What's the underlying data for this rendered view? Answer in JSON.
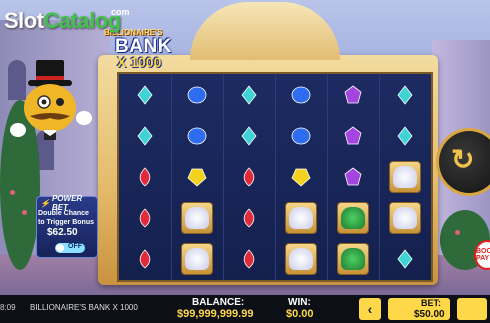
{
  "watermark": {
    "slot": "Slot",
    "catalog": "Catalog",
    "com": "com"
  },
  "logo": {
    "top": "RICHES SURGE",
    "name": "BILLIONAIRE'S",
    "bank": "BANK",
    "multiplier": "X 1000"
  },
  "power_bet": {
    "title": "POWER BET",
    "description": "Double Chance to Trigger Bonus",
    "amount": "$62.50",
    "toggle": "OFF"
  },
  "boom_badge": "BOOM PAY",
  "status_bar": {
    "time": "8:09",
    "game_name": "BILLIONAIRE'S BANK X 1000",
    "balance_label": "BALANCE:",
    "balance_value": "$99,999,999.99",
    "win_label": "WIN:",
    "win_value": "$0.00",
    "bet_label": "BET:",
    "bet_value": "$50.00",
    "prev_label": "‹"
  },
  "symbol_colors": {
    "cyan": "#3fd3d6",
    "blue": "#2f6df0",
    "purple": "#a445e0",
    "red": "#e02b3c",
    "yellow": "#f2d21e"
  },
  "reels": [
    [
      "cyan-gem",
      "cyan-gem",
      "red-gem",
      "red-gem",
      "red-gem"
    ],
    [
      "blue-gem",
      "blue-gem",
      "yellow-gem",
      "diamond-bag",
      "diamond-bag"
    ],
    [
      "cyan-gem",
      "cyan-gem",
      "red-gem",
      "red-gem",
      "red-gem"
    ],
    [
      "blue-gem",
      "blue-gem",
      "yellow-gem",
      "diamond-bag",
      "diamond-bag"
    ],
    [
      "purple-gem",
      "purple-gem",
      "purple-gem",
      "emerald-bag",
      "emerald-bag"
    ],
    [
      "cyan-gem",
      "cyan-gem",
      "diamond-bag",
      "diamond-bag",
      "cyan-gem"
    ]
  ]
}
